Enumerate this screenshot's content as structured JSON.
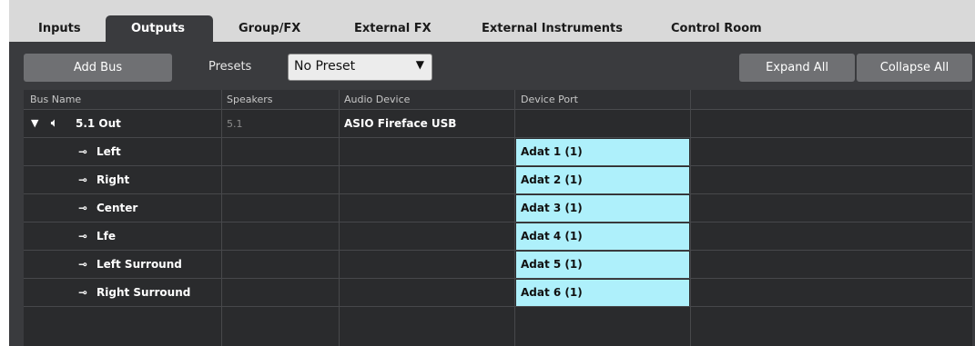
{
  "tabs": [
    {
      "label": "Inputs"
    },
    {
      "label": "Outputs"
    },
    {
      "label": "Group/FX"
    },
    {
      "label": "External FX"
    },
    {
      "label": "External Instruments"
    },
    {
      "label": "Control Room"
    }
  ],
  "toolbar": {
    "add_bus_label": "Add Bus",
    "presets_label": "Presets",
    "preset_value": "No Preset",
    "expand_all_label": "Expand All",
    "collapse_all_label": "Collapse All"
  },
  "columns": [
    "Bus Name",
    "Speakers",
    "Audio Device",
    "Device Port"
  ],
  "bus": {
    "name": "5.1 Out",
    "speakers": "5.1",
    "audio_device": "ASIO Fireface USB",
    "icon": "speaker-icon",
    "expander_icon": "triangle-down-icon"
  },
  "channels": [
    {
      "name": "Left",
      "port": "Adat 1 (1)",
      "icon": "plug-icon"
    },
    {
      "name": "Right",
      "port": "Adat 2 (1)",
      "icon": "plug-icon"
    },
    {
      "name": "Center",
      "port": "Adat 3 (1)",
      "icon": "plug-icon"
    },
    {
      "name": "Lfe",
      "port": "Adat 4 (1)",
      "icon": "plug-icon"
    },
    {
      "name": "Left Surround",
      "port": "Adat 5 (1)",
      "icon": "plug-icon"
    },
    {
      "name": "Right Surround",
      "port": "Adat 6 (1)",
      "icon": "plug-icon"
    }
  ],
  "colors": {
    "panel_bg": "#3a3b3e",
    "tab_strip_bg": "#d9d9d9",
    "port_highlight": "#aef0fb"
  }
}
